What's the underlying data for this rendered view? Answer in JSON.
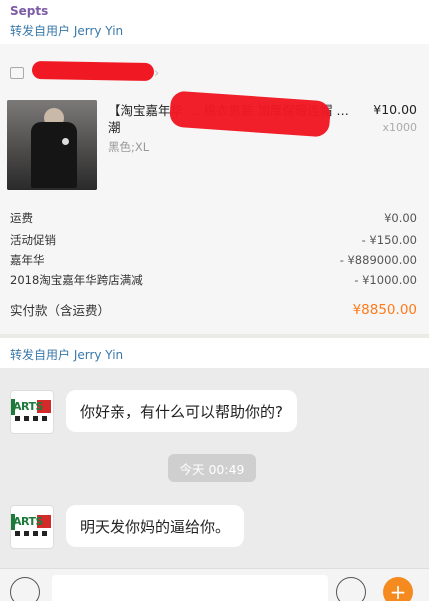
{
  "top_card": {
    "sender": "Septs",
    "forwarded_from": "转发自用户 Jerry Yin"
  },
  "order": {
    "shop_name": "",
    "product": {
      "title": "【淘宝嘉年华 … 棉衣男装 加厚保暖连帽 … 潮",
      "spec": "黑色;XL",
      "price": "¥10.00",
      "quantity": "x1000"
    },
    "fees": [
      {
        "label": "运费",
        "value": "¥0.00"
      },
      {
        "label": "活动促销",
        "value": "- ¥150.00"
      },
      {
        "label": "嘉年华",
        "value": "- ¥889000.00"
      },
      {
        "label": "2018淘宝嘉年华跨店满减",
        "value": "- ¥1000.00"
      }
    ],
    "total_label": "实付款（含运费）",
    "total_value": "¥8850.00"
  },
  "chat": {
    "forwarded_from": "转发自用户 Jerry Yin",
    "avatar_text": "ARTS",
    "messages": [
      {
        "text": "你好亲，有什么可以帮助你的?"
      },
      {
        "text": "明天发你妈的逼给你。"
      }
    ],
    "time_label": "今天 00:49"
  },
  "colors": {
    "accent": "#3a78a8",
    "sender": "#7b5aa6",
    "total_price": "#ff7a1a",
    "plus_button": "#f58a1f",
    "redaction": "#f01822"
  }
}
